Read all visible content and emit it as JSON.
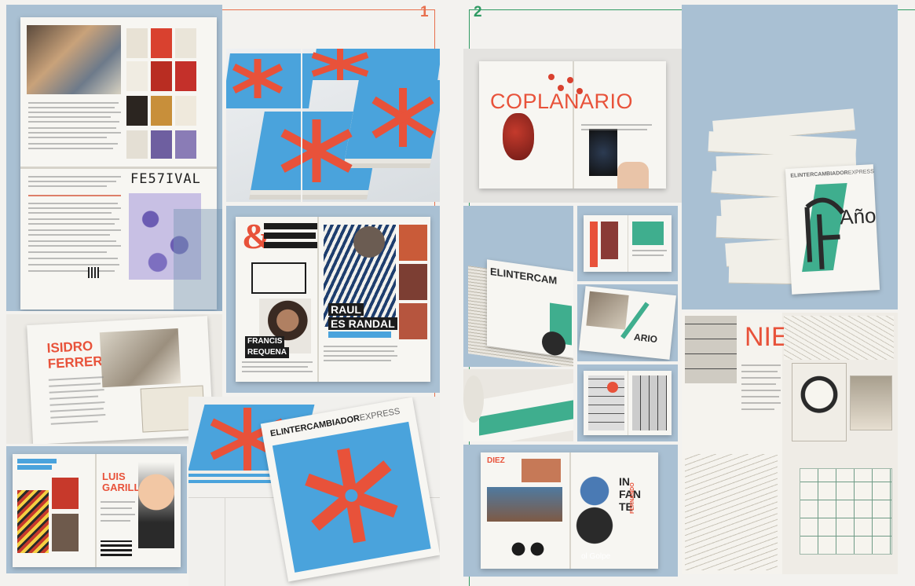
{
  "colors": {
    "background": "#f3f2ef",
    "blue_panel": "#a9c0d3",
    "page1_rule": "#e8704e",
    "page2_rule": "#2f9a63",
    "red_accent": "#e8523a",
    "teal_accent": "#3fae8e",
    "logo_blue": "#4aa3dc"
  },
  "page_markers": {
    "left_number": "1",
    "right_number": "2"
  },
  "printed_text": {
    "festival_title": "FE57IVAL",
    "francis": "FRANCIS",
    "requena": "REQUENA",
    "raul": "RAUL",
    "esrandal": "ES RANDAL",
    "isidro": "ISIDRO",
    "ferrer": "FERRER",
    "luis": "LUIS",
    "garillo": "GARILLO",
    "masthead_bold": "ELINTERCAMBIADOR",
    "masthead_light": "EXPRESS",
    "coplanario": "COPLANARIO",
    "nie": "NIE",
    "ano": "Año",
    "diez": "DIEZ",
    "infante_1": "IN",
    "infante_2": "FAN",
    "infante_3": "TE",
    "fernando": "FERNANDO",
    "intercam": "ELINTERCAM",
    "ario": "ARIO",
    "golpe": "ol Golpe"
  }
}
